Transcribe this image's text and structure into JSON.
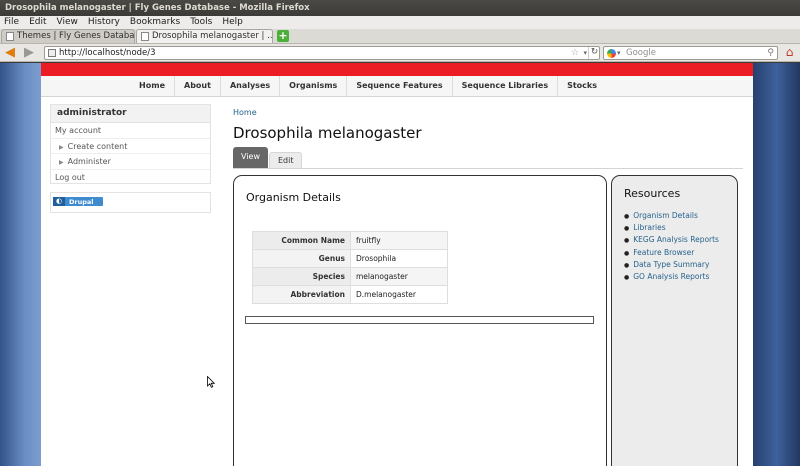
{
  "window": {
    "title": "Drosophila melanogaster | Fly Genes Database - Mozilla Firefox"
  },
  "menu": [
    "File",
    "Edit",
    "View",
    "History",
    "Bookmarks",
    "Tools",
    "Help"
  ],
  "tabs": [
    {
      "label": "Themes | Fly Genes Database"
    },
    {
      "label": "Drosophila melanogaster | ..."
    }
  ],
  "nav": {
    "url": "http://localhost/node/3",
    "search_placeholder": "Google"
  },
  "site": {
    "primary_nav": [
      "Home",
      "About",
      "Analyses",
      "Organisms",
      "Sequence Features",
      "Sequence Libraries",
      "Stocks"
    ],
    "sidebar": {
      "title": "administrator",
      "items": [
        "My account",
        "Create content",
        "Administer",
        "Log out"
      ],
      "badge": "Drupal"
    },
    "breadcrumb": "Home",
    "page_title": "Drosophila melanogaster",
    "tabs": [
      "View",
      "Edit"
    ],
    "details": {
      "title": "Organism Details",
      "rows": [
        {
          "key": "Common Name",
          "value": "fruitfly"
        },
        {
          "key": "Genus",
          "value": "Drosophila"
        },
        {
          "key": "Species",
          "value": "melanogaster"
        },
        {
          "key": "Abbreviation",
          "value": "D.melanogaster"
        }
      ]
    },
    "resources": {
      "title": "Resources",
      "links": [
        "Organism Details",
        "Libraries",
        "KEGG Analysis Reports",
        "Feature Browser",
        "Data Type Summary",
        "GO Analysis Reports"
      ]
    }
  },
  "colors": {
    "accent_red": "#ec1c24",
    "link_blue": "#27638c",
    "desktop_blue": "#4b6fa7"
  }
}
